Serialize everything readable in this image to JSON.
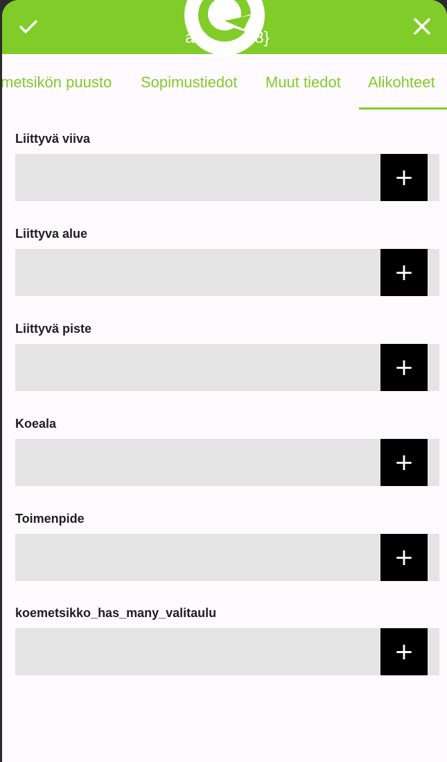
{
  "header": {
    "title": "{3ca              4f45-\naab8              aa08}",
    "confirm_icon": "check-icon",
    "close_icon": "close-icon",
    "accent_color": "#80cc28"
  },
  "tabs": [
    {
      "label": "metsikön puusto"
    },
    {
      "label": "Sopimustiedot"
    },
    {
      "label": "Muut tiedot"
    },
    {
      "label": "Alikohteet",
      "active": true
    }
  ],
  "fields": [
    {
      "label": "Liittyvä viiva",
      "add_label": "+"
    },
    {
      "label": "Liittyva alue",
      "add_label": "+"
    },
    {
      "label": "Liittyvä piste",
      "add_label": "+"
    },
    {
      "label": "Koeala",
      "add_label": "+"
    },
    {
      "label": "Toimenpide",
      "add_label": "+"
    },
    {
      "label": "koemetsikko_has_many_valitaulu",
      "add_label": "+"
    }
  ]
}
